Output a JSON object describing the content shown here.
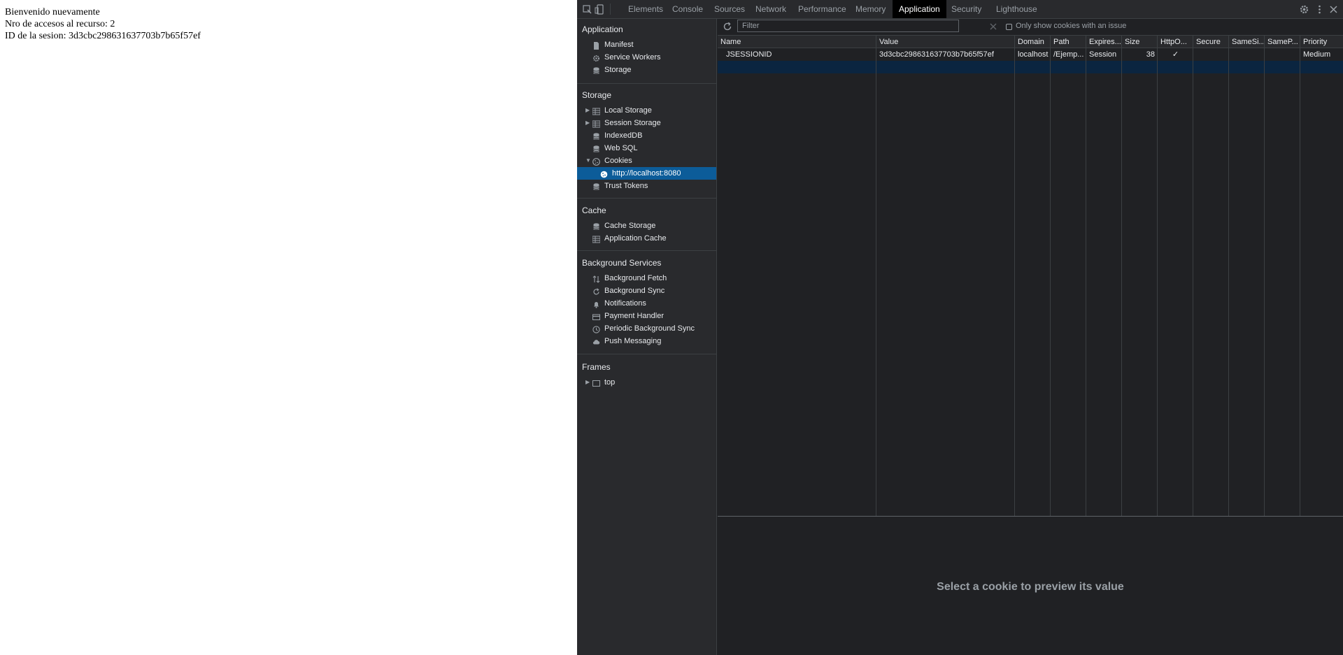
{
  "page": {
    "lines": [
      "Bienvenido nuevamente",
      "Nro de accesos al recurso: 2",
      "ID de la sesion: 3d3cbc298631637703b7b65f57ef"
    ]
  },
  "devtools": {
    "tabs": [
      "Elements",
      "Console",
      "Sources",
      "Network",
      "Performance",
      "Memory",
      "Application",
      "Security",
      "Lighthouse"
    ],
    "active_tab": "Application",
    "sidebar": {
      "application": {
        "title": "Application",
        "items": [
          "Manifest",
          "Service Workers",
          "Storage"
        ]
      },
      "storage": {
        "title": "Storage",
        "items": [
          "Local Storage",
          "Session Storage",
          "IndexedDB",
          "Web SQL",
          "Cookies",
          "http://localhost:8080",
          "Trust Tokens"
        ]
      },
      "cache": {
        "title": "Cache",
        "items": [
          "Cache Storage",
          "Application Cache"
        ]
      },
      "background": {
        "title": "Background Services",
        "items": [
          "Background Fetch",
          "Background Sync",
          "Notifications",
          "Payment Handler",
          "Periodic Background Sync",
          "Push Messaging"
        ]
      },
      "frames": {
        "title": "Frames",
        "items": [
          "top"
        ]
      }
    },
    "toolbar": {
      "filter_placeholder": "Filter",
      "only_issue_label": "Only show cookies with an issue"
    },
    "table": {
      "columns": [
        "Name",
        "Value",
        "Domain",
        "Path",
        "Expires...",
        "Size",
        "HttpO...",
        "Secure",
        "SameSi...",
        "SameP...",
        "Priority"
      ],
      "rows": [
        [
          "JSESSIONID",
          "3d3cbc298631637703b7b65f57ef",
          "localhost",
          "/Ejemp...",
          "Session",
          "38",
          "✓",
          "",
          "",
          "",
          "Medium"
        ]
      ]
    },
    "preview": {
      "message": "Select a cookie to preview its value"
    },
    "colors": {
      "selection": "#0c5c99",
      "panel_bg": "#202124",
      "sidebar_bg": "#292a2d"
    }
  }
}
